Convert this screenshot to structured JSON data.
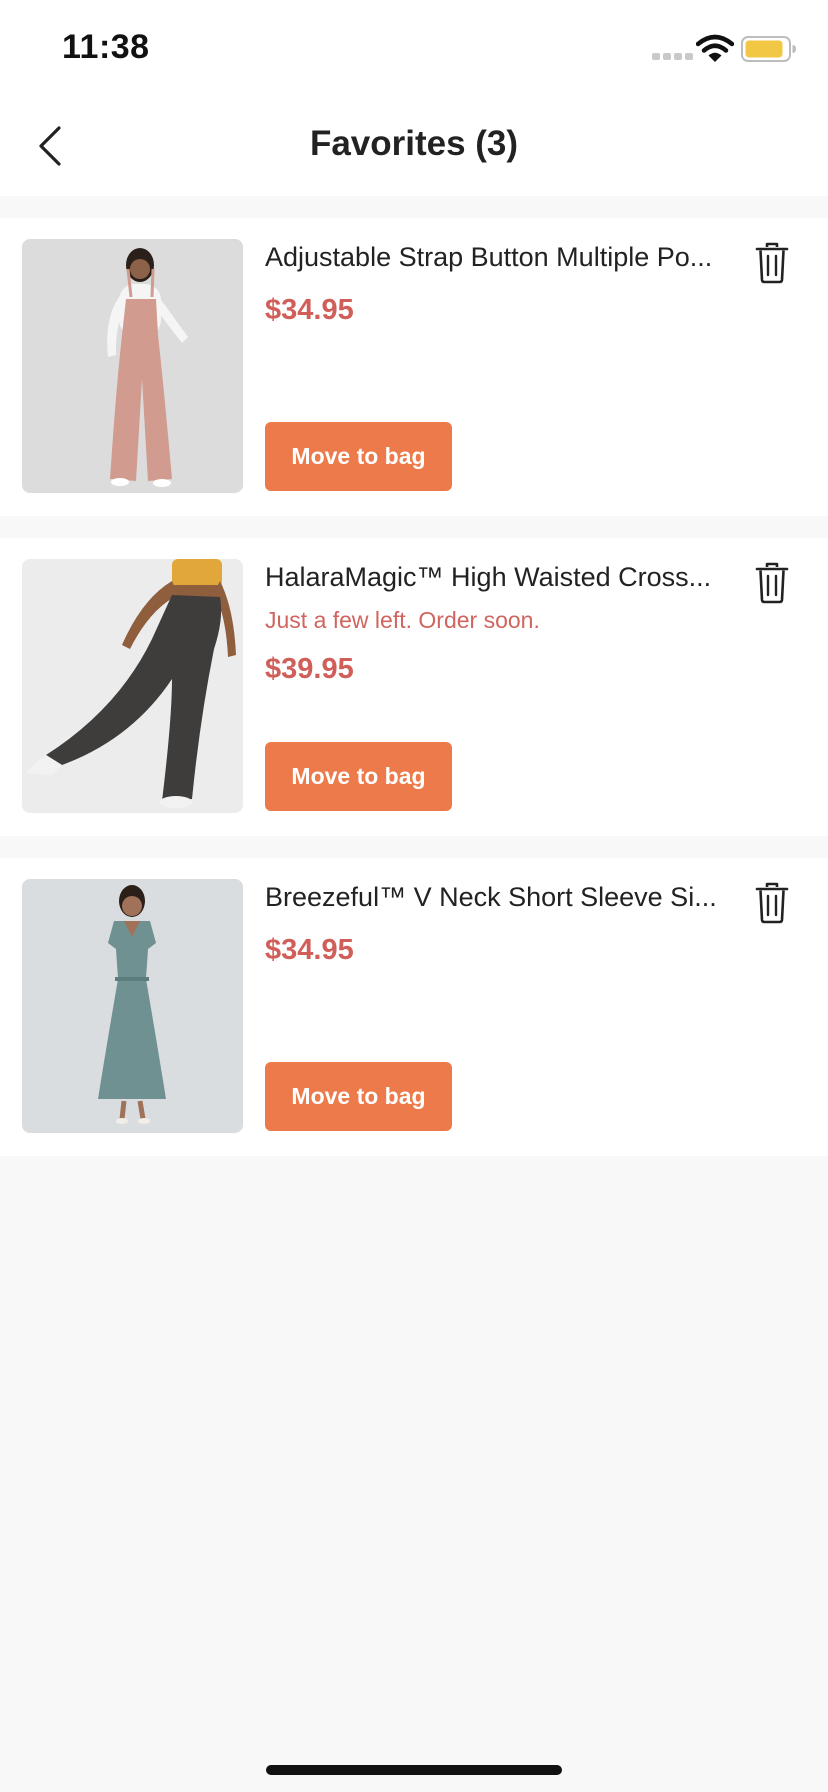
{
  "status_bar": {
    "time": "11:38"
  },
  "header": {
    "title": "Favorites (3)"
  },
  "items": [
    {
      "title": "Adjustable Strap Button Multiple Po...",
      "stock_note": "",
      "price": "$34.95",
      "button_label": "Move to bag",
      "image_colors": {
        "bg": "#dcdcdc",
        "garment": "#d29b8f",
        "top": "#f5f5f5",
        "skin": "#8c6248"
      }
    },
    {
      "title": "HalaraMagic™ High Waisted Cross...",
      "stock_note": "Just a few left. Order soon.",
      "price": "$39.95",
      "button_label": "Move to bag",
      "image_colors": {
        "bg": "#ececec",
        "garment": "#3f3d3b",
        "top": "#e1a73a",
        "skin": "#8e5e3d"
      }
    },
    {
      "title": "Breezeful™ V Neck Short Sleeve Si...",
      "stock_note": "",
      "price": "$34.95",
      "button_label": "Move to bag",
      "image_colors": {
        "bg": "#dadde0",
        "garment": "#6f9192",
        "top": "#6f9192",
        "skin": "#a07259"
      }
    }
  ],
  "colors": {
    "accent": "#ec7a4b",
    "price": "#cf5f58",
    "stock_warning": "#d0655f",
    "background": "#f8f8f8"
  },
  "icons": {
    "back": "chevron-left-icon",
    "delete": "trash-icon",
    "signal": "signal-icon",
    "wifi": "wifi-icon",
    "battery": "battery-icon"
  }
}
